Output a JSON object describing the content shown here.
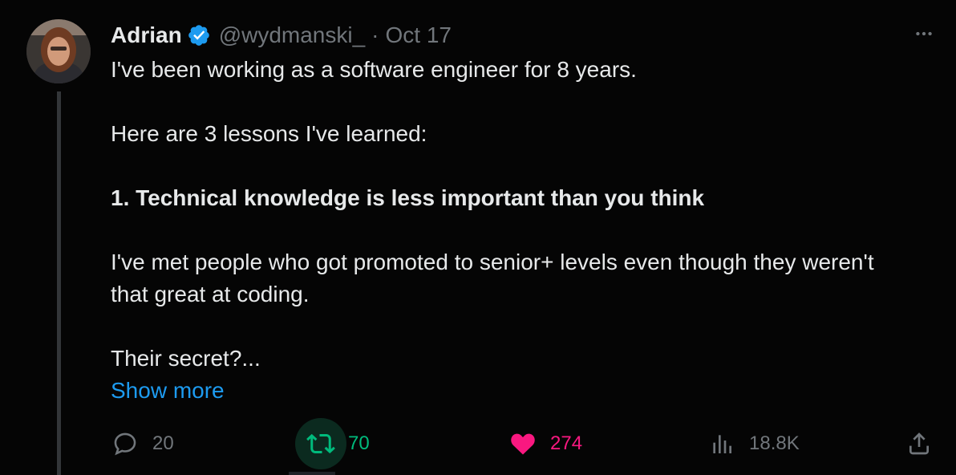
{
  "author": {
    "name": "Adrian",
    "handle": "@wydmanski_",
    "separator": "·",
    "date": "Oct 17",
    "verified": true
  },
  "tweet": {
    "lines": [
      "I've been working as a software engineer for 8 years.",
      "Here are 3 lessons I've learned:",
      "1. Technical knowledge is less important than you think",
      "I've met people who got promoted to senior+ levels even though they weren't that great at coding.",
      "Their secret?..."
    ],
    "show_more": "Show more"
  },
  "actions": {
    "replies": "20",
    "retweets": "70",
    "likes": "274",
    "views": "18.8K"
  },
  "colors": {
    "background": "#050505",
    "text": "#e7e9ea",
    "muted": "#71767b",
    "link": "#1d9bf0",
    "retweet": "#00ba7c",
    "like": "#f91880",
    "verified": "#1d9bf0"
  },
  "icons": [
    "more-icon",
    "verified-badge-icon",
    "reply-icon",
    "retweet-icon",
    "heart-icon",
    "views-icon",
    "share-icon"
  ]
}
